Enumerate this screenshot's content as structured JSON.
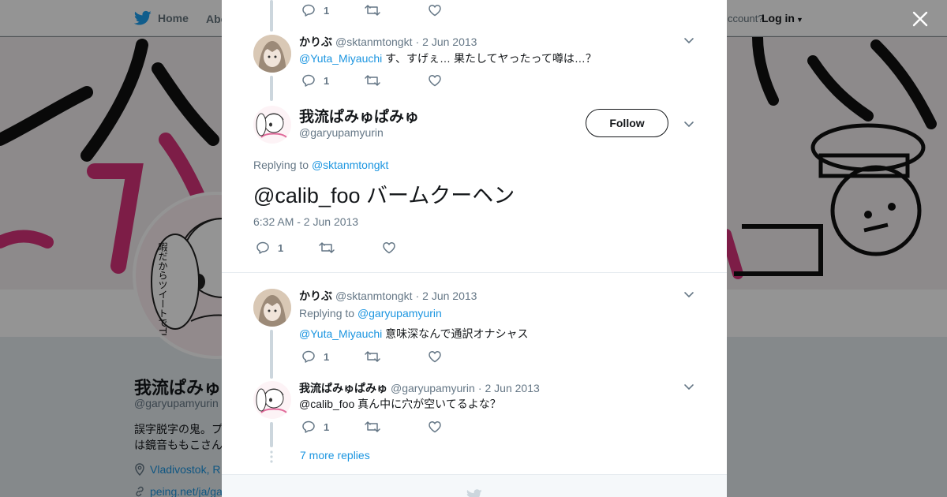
{
  "nav": {
    "home": "Home",
    "about": "Abo",
    "account_prompt": "ccount?",
    "login": "Log in"
  },
  "profile": {
    "name": "我流ぱみゅぱ",
    "handle": "@garyupamyurin",
    "bio_line1": "誤字脱字の鬼。プ",
    "bio_line2": "は鏡音ももこさん",
    "location": "Vladivostok, R",
    "link": "peing.net/ja/ga",
    "avatar_caption": "暇だからツイートでTLに不穏な流すか"
  },
  "thread": {
    "top_actions": {
      "replies": "1"
    },
    "reply1": {
      "name": "かりぶ",
      "handle": "@sktanmtongkt",
      "date": "2 Jun 2013",
      "mention": "@Yuta_Miyauchi",
      "text": " す、すげぇ… 果たしてヤったって噂は…？",
      "replies": "1"
    },
    "main": {
      "name": "我流ぱみゅぱみゅ",
      "handle": "@garyupamyurin",
      "follow_label": "Follow",
      "replying_label": "Replying to ",
      "replying_to": "@sktanmtongkt",
      "mention": "@calib_foo",
      "text": " バームクーヘン",
      "timestamp": "6:32 AM - 2 Jun 2013",
      "replies": "1"
    },
    "reply2": {
      "name": "かりぶ",
      "handle": "@sktanmtongkt",
      "date": "2 Jun 2013",
      "replying_label": "Replying to ",
      "replying_to": "@garyupamyurin",
      "mention": "@Yuta_Miyauchi",
      "text": " 意味深なんで通訳オナシャス",
      "replies": "1"
    },
    "reply3": {
      "name": "我流ぱみゅぱみゅ",
      "handle": "@garyupamyurin",
      "date": "2 Jun 2013",
      "mention": "@calib_foo",
      "text": " 真ん中に穴が空いてるよな？",
      "replies": "1"
    },
    "more_replies": "7 more replies"
  },
  "colors": {
    "accent": "#1b95e0",
    "twitter_blue": "#1da1f2",
    "banner_pink": "#d8337a",
    "text_secondary": "#657786"
  }
}
